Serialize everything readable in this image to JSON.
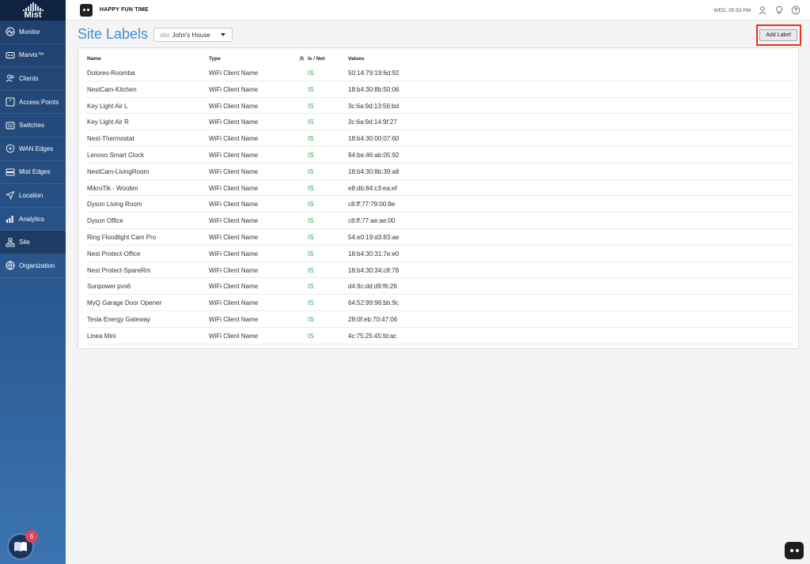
{
  "brand": {
    "logo_text": "Mist"
  },
  "sidebar": {
    "items": [
      {
        "label": "Monitor",
        "icon": "monitor-icon"
      },
      {
        "label": "Marvis™",
        "icon": "marvis-icon"
      },
      {
        "label": "Clients",
        "icon": "clients-icon"
      },
      {
        "label": "Access Points",
        "icon": "access-point-icon"
      },
      {
        "label": "Switches",
        "icon": "switch-icon"
      },
      {
        "label": "WAN Edges",
        "icon": "wan-edge-icon"
      },
      {
        "label": "Mist Edges",
        "icon": "mist-edge-icon"
      },
      {
        "label": "Location",
        "icon": "location-icon"
      },
      {
        "label": "Analytics",
        "icon": "analytics-icon"
      },
      {
        "label": "Site",
        "icon": "site-icon"
      },
      {
        "label": "Organization",
        "icon": "organization-icon"
      }
    ],
    "active": "Site",
    "help_badge": "6"
  },
  "header": {
    "org_name": "HAPPY FUN TIME",
    "time": "WED, 05:53 PM"
  },
  "page": {
    "title": "Site Labels",
    "site_prefix": "site",
    "site_value": "John's House",
    "add_label_button": "Add Label"
  },
  "table": {
    "columns": {
      "name": "Name",
      "type": "Type",
      "is_not": "Is / Not",
      "values": "Values"
    },
    "rows": [
      {
        "name": "Dolores-Roomba",
        "type": "WiFi Client Name",
        "is_not": "IS",
        "value": "50:14:79:19:6d:92"
      },
      {
        "name": "NestCam-Kitchen",
        "type": "WiFi Client Name",
        "is_not": "IS",
        "value": "18:b4:30:8b:50:06"
      },
      {
        "name": "Key Light Air L",
        "type": "WiFi Client Name",
        "is_not": "IS",
        "value": "3c:6a:9d:13:56:bd"
      },
      {
        "name": "Key Light Air R",
        "type": "WiFi Client Name",
        "is_not": "IS",
        "value": "3c:6a:9d:14:9f:27"
      },
      {
        "name": "Nest-Thermostat",
        "type": "WiFi Client Name",
        "is_not": "IS",
        "value": "18:b4:30:00:07:60"
      },
      {
        "name": "Lenovo Smart Clock",
        "type": "WiFi Client Name",
        "is_not": "IS",
        "value": "94:be:46:ab:05:92"
      },
      {
        "name": "NestCam-LivingRoom",
        "type": "WiFi Client Name",
        "is_not": "IS",
        "value": "18:b4:30:8b:39:a8"
      },
      {
        "name": "MikroTik - Woobm",
        "type": "WiFi Client Name",
        "is_not": "IS",
        "value": "e8:db:84:c3:ea:ef"
      },
      {
        "name": "Dyson Living Room",
        "type": "WiFi Client Name",
        "is_not": "IS",
        "value": "c8:ff:77:79:00:8e"
      },
      {
        "name": "Dyson Office",
        "type": "WiFi Client Name",
        "is_not": "IS",
        "value": "c8:ff:77:ae:ae:00"
      },
      {
        "name": "Ring Floodlight Cam Pro",
        "type": "WiFi Client Name",
        "is_not": "IS",
        "value": "54:e0:19:d3:83:ae"
      },
      {
        "name": "Nest Protect-Office",
        "type": "WiFi Client Name",
        "is_not": "IS",
        "value": "18:b4:30:31:7e:e0"
      },
      {
        "name": "Nest Protect-SpareRm",
        "type": "WiFi Client Name",
        "is_not": "IS",
        "value": "18:b4:30:34:c8:78"
      },
      {
        "name": "Sunpower pvs6",
        "type": "WiFi Client Name",
        "is_not": "IS",
        "value": "d4:9c:dd:d9:f6:26"
      },
      {
        "name": "MyQ Garage Door Opener",
        "type": "WiFi Client Name",
        "is_not": "IS",
        "value": "64:52:99:96:bb:9c"
      },
      {
        "name": "Tesla Energy Gateway",
        "type": "WiFi Client Name",
        "is_not": "IS",
        "value": "28:0f:eb:70:47:06"
      },
      {
        "name": "Linea Mini",
        "type": "WiFi Client Name",
        "is_not": "IS",
        "value": "4c:75:25:45:fd:ac"
      }
    ]
  },
  "colors": {
    "accent": "#3d8fd6",
    "status_is": "#3aa14a",
    "highlight": "#e2361b"
  }
}
